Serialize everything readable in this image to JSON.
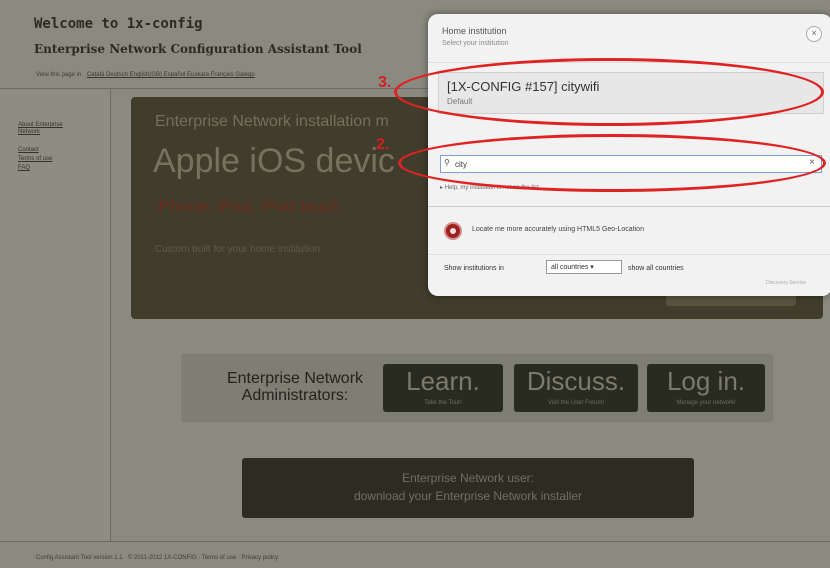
{
  "header": {
    "title": "Welcome to 1x-config",
    "subtitle": "Enterprise Network Configuration Assistant Tool",
    "breadcrumb_text": "View this page in",
    "breadcrumb_links": "Català  Deutsch  English(GB)  Español  Euskara  Français  Galego"
  },
  "left_nav": {
    "items": [
      "About Enterprise Network",
      "Contact",
      "Terms of use",
      "FAQ"
    ]
  },
  "hero": {
    "line1": "Enterprise Network installation m",
    "title": "Apple iOS devic",
    "subtitle": "iPhone, iPad, iPod touch",
    "small": "Custom built for your home institution"
  },
  "admins": {
    "label": "Enterprise Network Administrators:",
    "buttons": [
      {
        "title": "Learn.",
        "sub": "Take the Tour!"
      },
      {
        "title": "Discuss.",
        "sub": "Visit the User Forum!"
      },
      {
        "title": "Log in.",
        "sub": "Manage your network!"
      }
    ]
  },
  "download": {
    "line1": "Enterprise Network user:",
    "line2": "download your Enterprise Network installer"
  },
  "footer": {
    "text": "Config Assistant Tool version 1.1  ·  © 2011-2012 1X-CONFIG  ·  Terms of use  ·  Privacy policy"
  },
  "popup": {
    "title": "Home institution",
    "subtitle": "Select your institution",
    "close": "×",
    "result": {
      "name": "[1X-CONFIG #157] citywifi",
      "sub": "Default"
    },
    "search": {
      "value": "city",
      "clear": "×",
      "icon": "search-icon"
    },
    "help_text": "Help, my institution is not on the list",
    "geo_text": "Locate me more accurately using HTML5 Geo-Location",
    "show_label": "Show institutions in",
    "country_select": "all countries ▾",
    "show_all": "show all countries",
    "powered": "Discovery Service"
  },
  "annotations": {
    "step3": "3.",
    "step2": "2.",
    "color": "#e02222"
  }
}
